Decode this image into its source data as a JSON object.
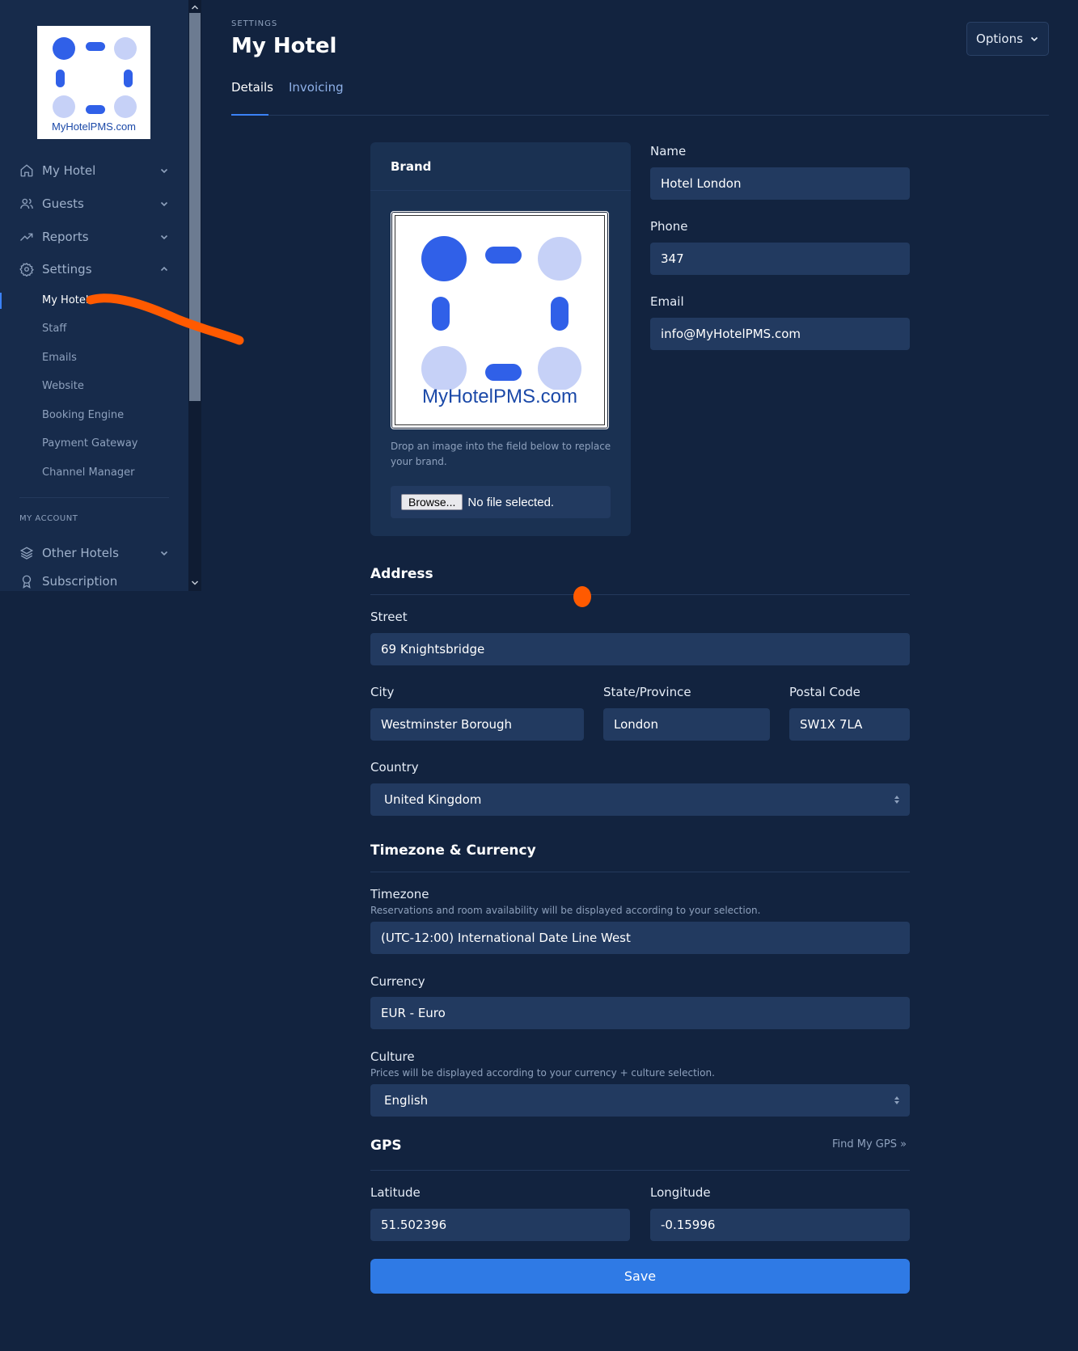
{
  "sidebar": {
    "logo_text": "MyHotelPMS.com",
    "nav": [
      {
        "label": "My Hotel",
        "icon": "home-icon",
        "state": "collapsed"
      },
      {
        "label": "Guests",
        "icon": "users-icon",
        "state": "collapsed"
      },
      {
        "label": "Reports",
        "icon": "trending-up-icon",
        "state": "collapsed"
      },
      {
        "label": "Settings",
        "icon": "gear-icon",
        "state": "expanded"
      }
    ],
    "settings_sub": [
      "My Hotel",
      "Staff",
      "Emails",
      "Website",
      "Booking Engine",
      "Payment Gateway",
      "Channel Manager"
    ],
    "active_sub": "My Hotel",
    "account_caption": "MY ACCOUNT",
    "account_nav": [
      {
        "label": "Other Hotels",
        "icon": "layers-icon"
      },
      {
        "label": "Subscription",
        "icon": "award-icon"
      }
    ]
  },
  "header": {
    "eyebrow": "SETTINGS",
    "title": "My Hotel",
    "options_label": "Options",
    "tabs": [
      {
        "label": "Details",
        "active": true
      },
      {
        "label": "Invoicing",
        "active": false
      }
    ]
  },
  "brand": {
    "title": "Brand",
    "image_text": "MyHotelPMS.com",
    "help": "Drop an image into the field below to replace your brand.",
    "browse_label": "Browse...",
    "file_status": "No file selected."
  },
  "contact": {
    "name_label": "Name",
    "name_value": "Hotel London",
    "phone_label": "Phone",
    "phone_value": "347",
    "email_label": "Email",
    "email_value": "info@MyHotelPMS.com"
  },
  "address": {
    "title": "Address",
    "street_label": "Street",
    "street_value": "69 Knightsbridge",
    "city_label": "City",
    "city_value": "Westminster Borough",
    "state_label": "State/Province",
    "state_value": "London",
    "postal_label": "Postal Code",
    "postal_value": "SW1X 7LA",
    "country_label": "Country",
    "country_value": "United Kingdom"
  },
  "tz_currency": {
    "title": "Timezone & Currency",
    "timezone_label": "Timezone",
    "timezone_hint": "Reservations and room availability will be displayed according to your selection.",
    "timezone_value": "(UTC-12:00) International Date Line West",
    "currency_label": "Currency",
    "currency_value": "EUR - Euro",
    "culture_label": "Culture",
    "culture_hint": "Prices will be displayed according to your currency + culture selection.",
    "culture_value": "English"
  },
  "gps": {
    "title": "GPS",
    "find_link": "Find My GPS »",
    "lat_label": "Latitude",
    "lat_value": "51.502396",
    "lon_label": "Longitude",
    "lon_value": "-0.15996"
  },
  "save_label": "Save",
  "colors": {
    "background": "#12233f",
    "sidebar": "#172b4b",
    "input": "#223a60",
    "accent": "#2f7ae5",
    "annotation": "#ff5a00",
    "logo_blue": "#3060e8",
    "logo_light": "#c6d1f7"
  }
}
